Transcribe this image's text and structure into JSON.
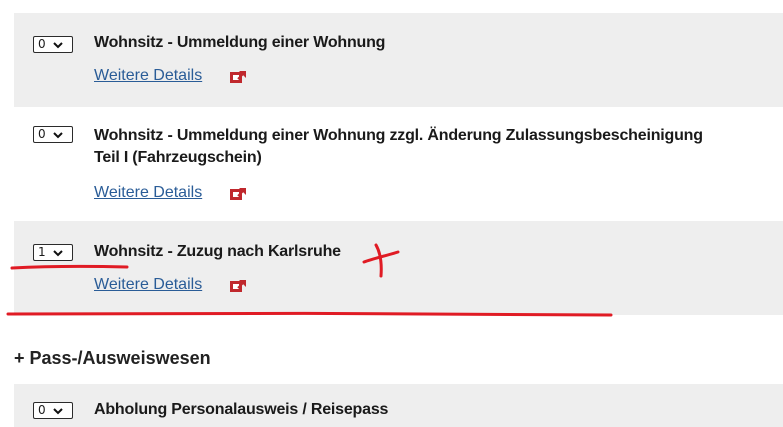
{
  "items": [
    {
      "qty": "0",
      "title": "Wohnsitz - Ummeldung einer Wohnung",
      "title_line2": "",
      "details_label": "Weitere Details"
    },
    {
      "qty": "0",
      "title": "Wohnsitz - Ummeldung einer Wohnung zzgl. Änderung Zulassungsbescheinigung",
      "title_line2": "Teil I (Fahrzeugschein)",
      "details_label": "Weitere Details"
    },
    {
      "qty": "1",
      "title": "Wohnsitz - Zuzug nach Karlsruhe",
      "title_line2": "",
      "details_label": "Weitere Details"
    },
    {
      "qty": "0",
      "title": "Abholung Personalausweis / Reisepass",
      "title_line2": "",
      "details_label": ""
    }
  ],
  "section": {
    "heading": "+ Pass-/Ausweiswesen"
  },
  "colors": {
    "shaded_bg": "#eeeeee",
    "link": "#2a5c97",
    "external_icon": "#c0282d",
    "annotation_red": "#e01b24"
  },
  "icons": {
    "select_arrow": "chevron-down-icon",
    "details_link": "external-link-icon"
  }
}
